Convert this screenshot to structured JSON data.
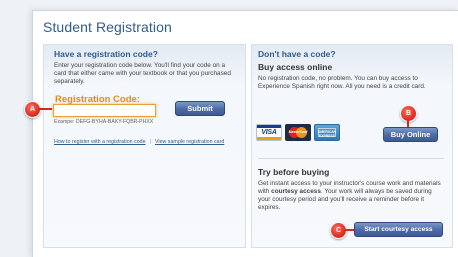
{
  "page": {
    "title": "Student Registration"
  },
  "left": {
    "heading": "Have a registration code?",
    "intro": "Enter your registration code below. You'll find your code on a card that either came with your textbook or that you purchased separately.",
    "code_label": "Registration Code:",
    "code_value": "",
    "submit_label": "Submit",
    "example": "Exampe: DEFG-BYHA-BAKY-FQBR-PHXX",
    "links": {
      "how_to": "How to register with a registration code",
      "separator": "|",
      "sample": "View sample registration card"
    }
  },
  "right": {
    "heading": "Don't have a code?",
    "buy_heading": "Buy access online",
    "buy_text": "No registration code, no problem. You can buy access to Experience Spanish right now. All you need is a credit card.",
    "cards": [
      {
        "name": "visa-card-icon",
        "label": "VISA"
      },
      {
        "name": "mastercard-icon",
        "label": "MasterCard"
      },
      {
        "name": "amex-card-icon",
        "label": "AMERICAN EXPRESS"
      }
    ],
    "buy_button": "Buy Online",
    "try_heading": "Try before buying",
    "try_text_1": "Get instant access to your instructor's course work and materials with ",
    "try_text_bold": "courtesy access",
    "try_text_2": ". Your work will always be saved during your courtesy period and you'll receive a reminder before it expires.",
    "courtesy_button": "Start courtesy access"
  },
  "markers": {
    "a": "A",
    "b": "B",
    "c": "C"
  },
  "colors": {
    "accent": "#2f5d8c",
    "button": "#4c6aa6",
    "label": "#e38a1e",
    "marker": "#d8281d"
  }
}
